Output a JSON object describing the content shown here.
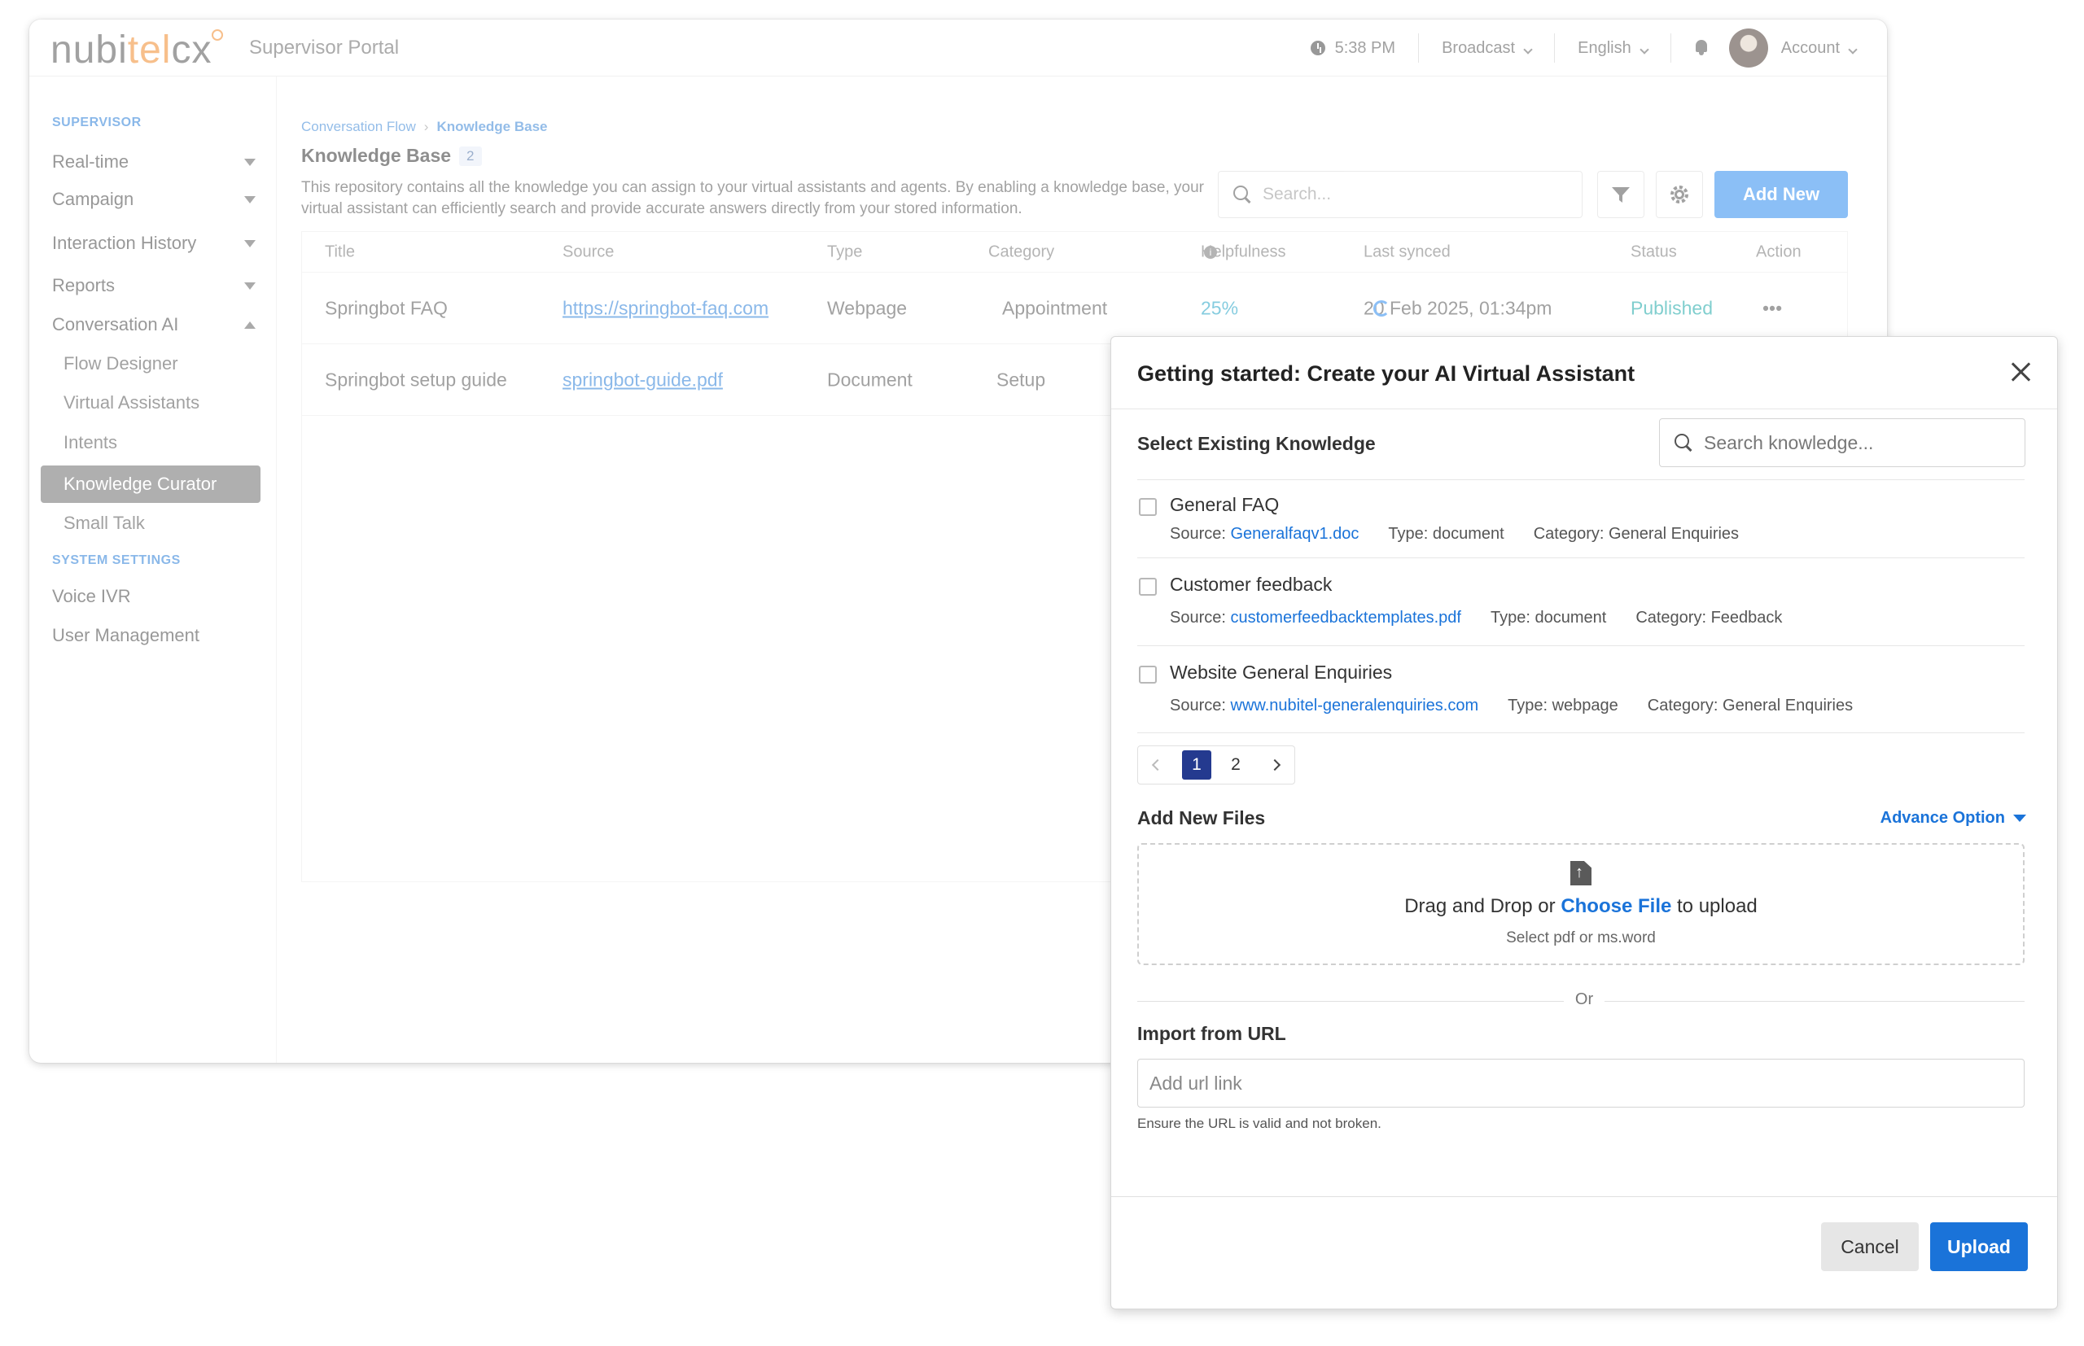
{
  "app": {
    "logo": {
      "part1": "nubi",
      "part2": "tel",
      "part3": "cx"
    },
    "portal_name": "Supervisor Portal",
    "time": "5:38 PM",
    "broadcast": "Broadcast",
    "language": "English",
    "account": "Account"
  },
  "sidebar": {
    "section_supervisor": "SUPERVISOR",
    "realtime": "Real-time",
    "campaign": "Campaign",
    "interaction_history": "Interaction History",
    "reports": "Reports",
    "conversation_ai": "Conversation AI",
    "flow_designer": "Flow Designer",
    "virtual_assistants": "Virtual Assistants",
    "intents": "Intents",
    "knowledge_curator": "Knowledge Curator",
    "small_talk": "Small Talk",
    "section_system": "SYSTEM SETTINGS",
    "voice_ivr": "Voice IVR",
    "user_management": "User Management"
  },
  "main": {
    "breadcrumb": {
      "parent": "Conversation Flow",
      "separator": "›",
      "current": "Knowledge Base"
    },
    "title": "Knowledge Base",
    "count": "2",
    "description": "This repository contains all the knowledge you can assign to your virtual assistants and agents. By enabling a knowledge base, your virtual assistant can efficiently search and provide accurate answers directly from your stored information.",
    "search_placeholder": "Search...",
    "add_new": "Add New",
    "columns": {
      "title": "Title",
      "source": "Source",
      "type": "Type",
      "category": "Category",
      "helpfulness": "Helpfulness",
      "last_synced": "Last synced",
      "status": "Status",
      "action": "Action"
    },
    "rows": [
      {
        "title": "Springbot FAQ",
        "source": "https://springbot-faq.com",
        "type": "Webpage",
        "category": "Appointment",
        "helpfulness": "25%",
        "last_synced": "20 Feb 2025, 01:34pm",
        "status": "Published",
        "action": "•••"
      },
      {
        "title": "Springbot setup guide",
        "source": "springbot-guide.pdf",
        "type": "Document",
        "category": "Setup"
      }
    ]
  },
  "modal": {
    "title": "Getting started: Create your AI Virtual Assistant",
    "select_existing": "Select Existing Knowledge",
    "search_knowledge_placeholder": "Search knowledge...",
    "items": [
      {
        "name": "General FAQ",
        "source_label": "Source:",
        "source": "Generalfaqv1.doc",
        "type": "Type: document",
        "category": "Category: General Enquiries"
      },
      {
        "name": "Customer feedback",
        "source_label": "Source:",
        "source": "customerfeedbacktemplates.pdf",
        "type": "Type: document",
        "category": "Category: Feedback"
      },
      {
        "name": "Website General Enquiries",
        "source_label": "Source:",
        "source": "www.nubitel-generalenquiries.com",
        "type": "Type: webpage",
        "category": "Category: General Enquiries"
      }
    ],
    "pagination": {
      "current": "1",
      "next": "2"
    },
    "add_new_files": "Add New Files",
    "advance_option": "Advance Option",
    "drop": {
      "prefix": "Drag and Drop or",
      "choose": "Choose File",
      "suffix": "to upload",
      "hint": "Select pdf or ms.word"
    },
    "or": "Or",
    "import_url": "Import from URL",
    "url_placeholder": "Add url link",
    "url_help": "Ensure the URL is valid and not broken.",
    "cancel": "Cancel",
    "upload": "Upload"
  }
}
